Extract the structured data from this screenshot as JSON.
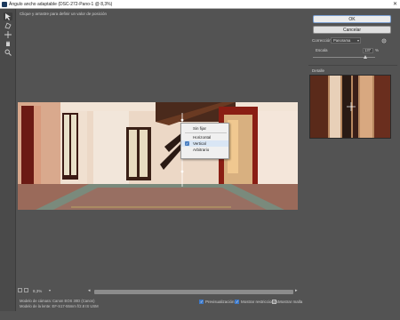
{
  "window": {
    "title": "Ángulo ancho adaptable (DSC-272-Pano-1 @ 8,3%)",
    "close_glyph": "✕"
  },
  "hint": "Clique y arrastre para definir un valor de posición",
  "tools": [
    {
      "name": "constraint-tool-icon",
      "active": true
    },
    {
      "name": "polygon-constraint-tool-icon",
      "active": false
    },
    {
      "name": "move-tool-icon",
      "active": false
    },
    {
      "name": "hand-tool-icon",
      "active": false
    },
    {
      "name": "zoom-tool-icon",
      "active": false
    }
  ],
  "context_menu": {
    "items": [
      {
        "label": "Sin fijar",
        "checked": false
      },
      {
        "label": "Horizontal",
        "checked": false
      },
      {
        "label": "Vertical",
        "checked": true
      },
      {
        "label": "Arbitrario",
        "checked": false
      }
    ]
  },
  "right_panel": {
    "ok_label": "OK",
    "cancel_label": "Cancelar",
    "correction_label": "Corrección:",
    "correction_value": "Panorama",
    "scale_label": "Escala",
    "scale_value": "137",
    "scale_unit": "%",
    "detail_label": "Detalle"
  },
  "bottom": {
    "zoom_value": "8,3%",
    "camera_model": "Modelo de cámara: Canon EOS 30D (Canon)",
    "lens_model": "Modelo de la lente: EF-S17-55mm f/2.8 IS USM",
    "checkboxes": [
      {
        "label": "Previsualización",
        "checked": true
      },
      {
        "label": "Mostrar restricciones",
        "checked": true
      },
      {
        "label": "Mostrar malla",
        "checked": false
      }
    ]
  },
  "colors": {
    "accent": "#3c78c8",
    "panel_bg": "#535353"
  }
}
